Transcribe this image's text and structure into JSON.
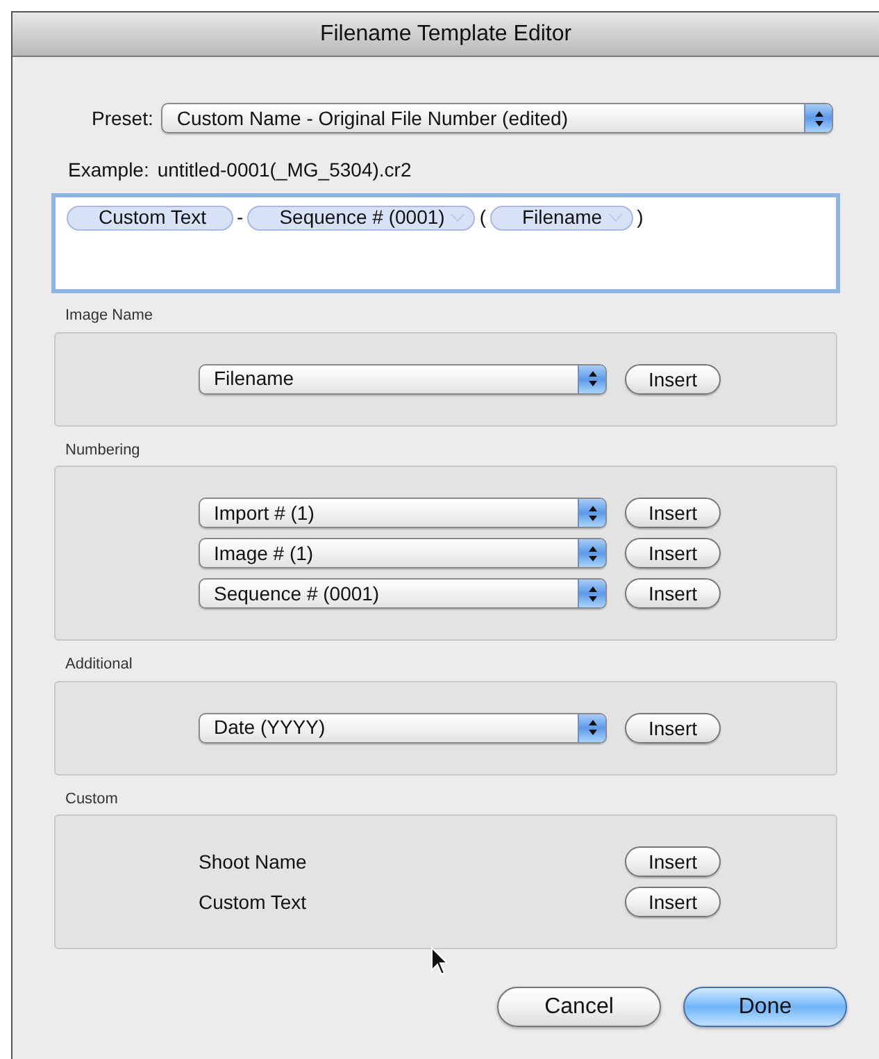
{
  "window": {
    "title": "Filename Template Editor"
  },
  "preset": {
    "label": "Preset:",
    "value": "Custom Name - Original File Number (edited)"
  },
  "example": {
    "label": "Example:",
    "value": "untitled-0001(_MG_5304).cr2"
  },
  "template": [
    {
      "kind": "token",
      "text": "Custom Text",
      "has_menu": false
    },
    {
      "kind": "separator",
      "text": "-"
    },
    {
      "kind": "token",
      "text": "Sequence # (0001)",
      "has_menu": true
    },
    {
      "kind": "separator",
      "text": "("
    },
    {
      "kind": "token",
      "text": "Filename",
      "has_menu": true
    },
    {
      "kind": "separator",
      "text": ")"
    }
  ],
  "sections": [
    {
      "title": "Image Name",
      "rows": [
        {
          "kind": "popup",
          "value": "Filename",
          "button": "Insert"
        }
      ]
    },
    {
      "title": "Numbering",
      "rows": [
        {
          "kind": "popup",
          "value": "Import # (1)",
          "button": "Insert"
        },
        {
          "kind": "popup",
          "value": "Image # (1)",
          "button": "Insert"
        },
        {
          "kind": "popup",
          "value": "Sequence # (0001)",
          "button": "Insert"
        }
      ]
    },
    {
      "title": "Additional",
      "rows": [
        {
          "kind": "popup",
          "value": "Date (YYYY)",
          "button": "Insert"
        }
      ]
    },
    {
      "title": "Custom",
      "rows": [
        {
          "kind": "label",
          "value": "Shoot Name",
          "button": "Insert"
        },
        {
          "kind": "label",
          "value": "Custom Text",
          "button": "Insert"
        }
      ]
    }
  ],
  "buttons": [
    {
      "label": "Cancel",
      "default": false
    },
    {
      "label": "Done",
      "default": true
    }
  ]
}
